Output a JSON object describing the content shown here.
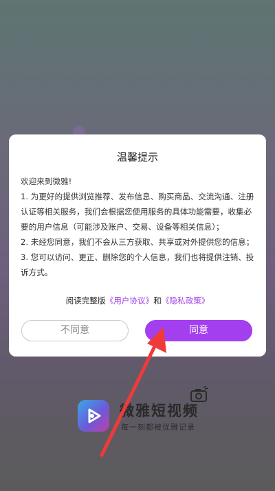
{
  "dialog": {
    "title": "温馨提示",
    "paragraphs": [
      "欢迎来到微雅!",
      "1. 为更好的提供浏览推荐、发布信息、购买商品、交流沟通、注册认证等相关服务，我们会根据您使用服务的具体功能需要，收集必要的用户信息（可能涉及账户、交易、设备等相关信息）；",
      " 2. 未经您同意，我们不会从三方获取、共享或对外提供您的信息；",
      " 3. 您可以访问、更正、删除您的个人信息，我们也将提供注销、投诉方式。"
    ],
    "read_prefix": "阅读完整版",
    "user_agreement_link": "《用户协议》",
    "and_text": "和",
    "privacy_policy_link": "《隐私政策》",
    "disagree_label": "不同意",
    "agree_label": "同意"
  },
  "brand": {
    "name": "微雅短视频",
    "slogan": "每一刻都被优雅记录"
  },
  "colors": {
    "accent": "#a43ff0",
    "annotation_arrow": "#f03a3a"
  },
  "icons": [
    "play-logo-icon",
    "camera-icon",
    "annotation-arrow"
  ]
}
